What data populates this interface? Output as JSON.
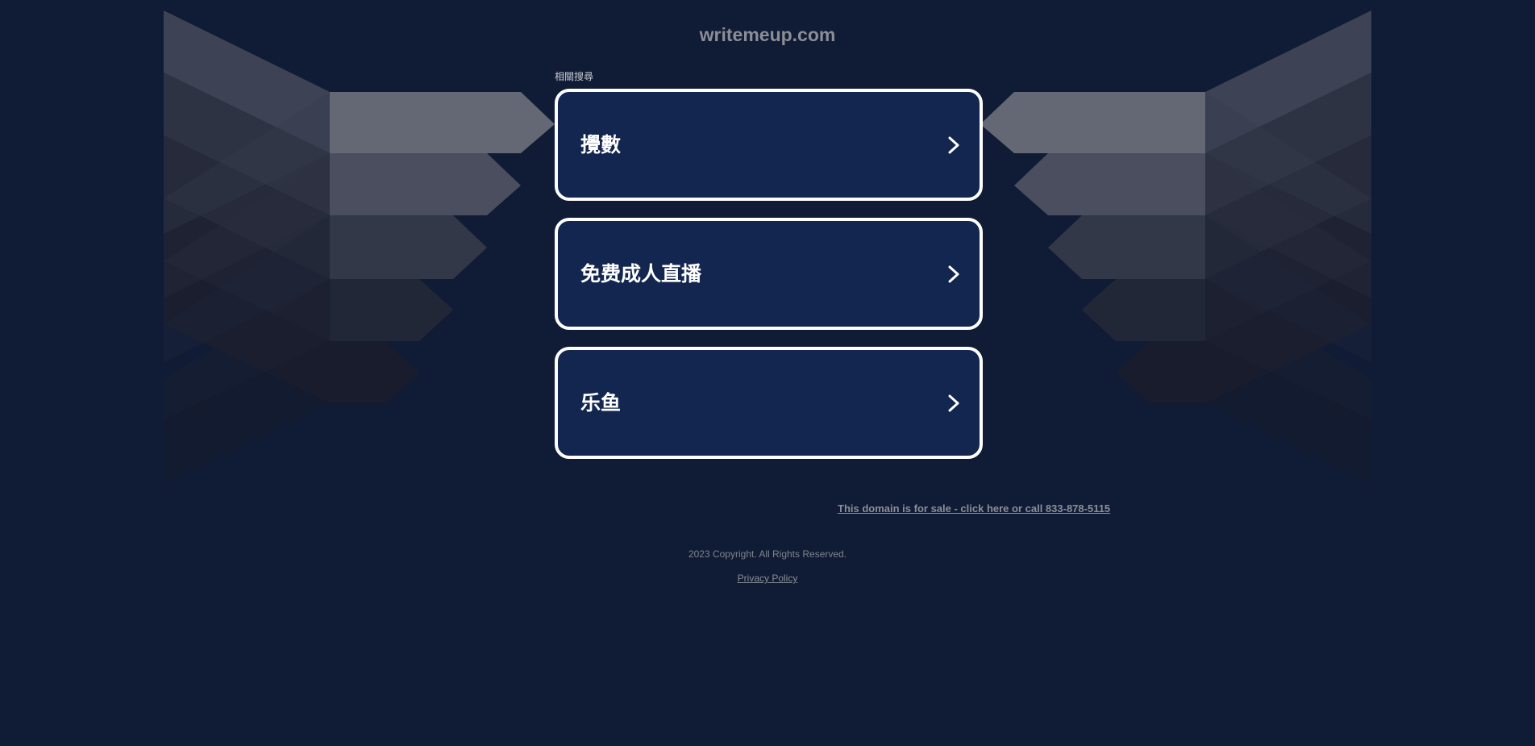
{
  "site": {
    "domain_title": "writemeup.com"
  },
  "search": {
    "section_label": "相關搜尋",
    "results": [
      {
        "label": "攪數"
      },
      {
        "label": "免费成人直播"
      },
      {
        "label": "乐鱼"
      }
    ]
  },
  "footer": {
    "sale_link": "This domain is for sale - click here or call 833-878-5115",
    "copyright": "2023 Copyright. All Rights Reserved.",
    "privacy_link": "Privacy Policy"
  },
  "colors": {
    "background": "#101c36",
    "card_background": "#13264f",
    "card_border": "#ffffff",
    "muted_text": "#8b8e97"
  },
  "icons": {
    "card_arrow": "chevron-right-icon"
  }
}
